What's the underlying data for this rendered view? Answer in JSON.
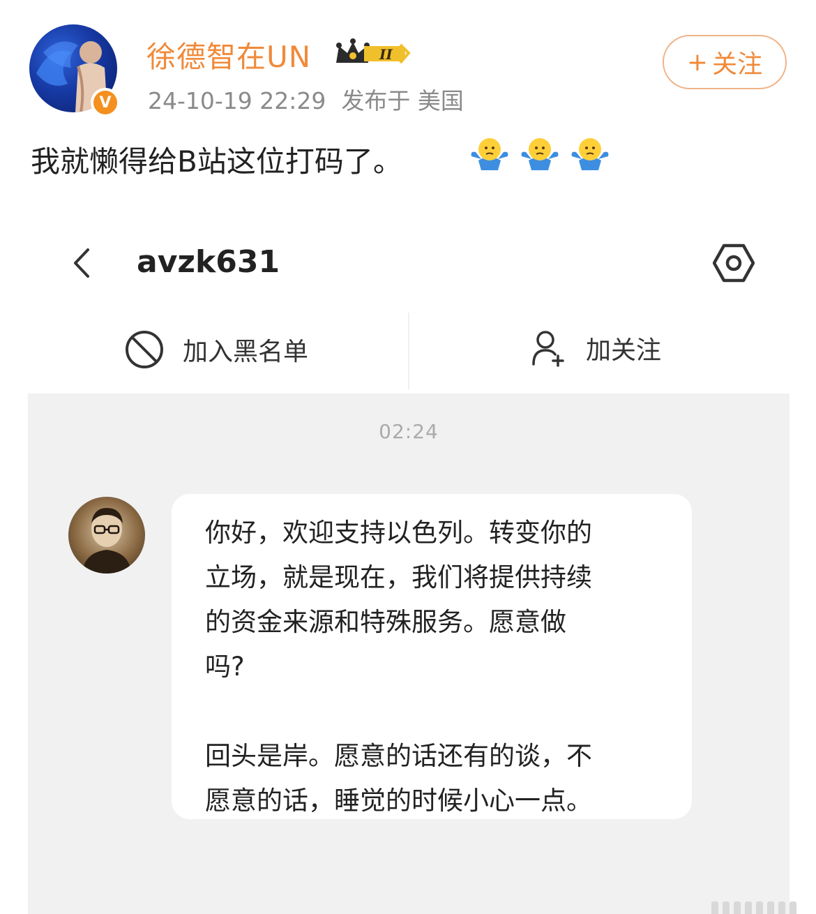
{
  "post": {
    "author": {
      "name": "徐德智在UN",
      "vip_level": "II",
      "verified_mark": "V"
    },
    "meta": {
      "timestamp": "24-10-19 22:29",
      "location": "发布于 美国"
    },
    "follow_button": {
      "icon": "+",
      "label": "关注"
    },
    "text": "我就懒得给B站这位打码了。",
    "emojis": [
      "shrug-emoji",
      "shrug-emoji",
      "shrug-emoji"
    ]
  },
  "chat": {
    "username": "avzk631",
    "actions": {
      "block_label": "加入黑名单",
      "follow_label": "加关注"
    },
    "message_time": "02:24",
    "message_lines": [
      "你好，欢迎支持以色列。转变你的",
      "立场，就是现在，我们将提供持续",
      "的资金来源和特殊服务。愿意做",
      "吗?",
      "",
      "回头是岸。愿意的话还有的谈，不",
      "愿意的话，睡觉的时候小心一点。"
    ]
  },
  "colors": {
    "accent_orange": "#f08a3a",
    "meta_gray": "#8a8a8a",
    "chat_background": "#f1f1f2",
    "bubble_background": "#ffffff"
  }
}
